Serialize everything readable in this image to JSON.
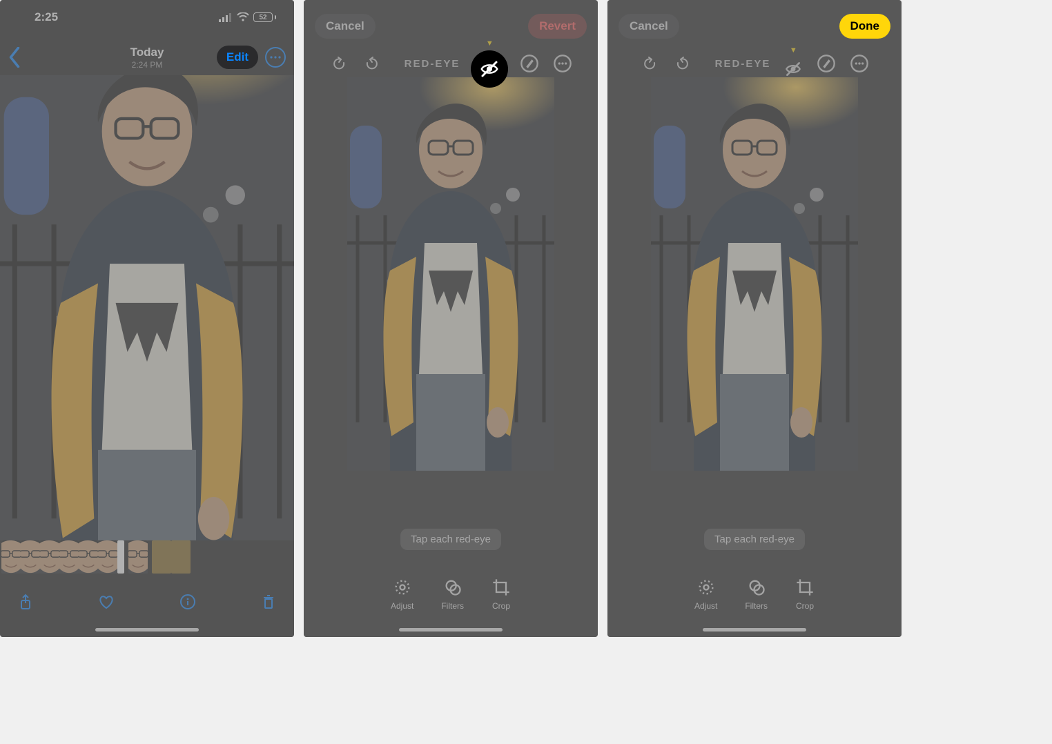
{
  "screen1": {
    "status": {
      "time": "2:25",
      "battery": "52"
    },
    "nav": {
      "title": "Today",
      "subtitle": "2:24 PM",
      "edit_label": "Edit"
    }
  },
  "screen2": {
    "cancel_label": "Cancel",
    "revert_label": "Revert",
    "tool_label": "RED-EYE",
    "hint": "Tap each red-eye",
    "modes": {
      "adjust": "Adjust",
      "filters": "Filters",
      "crop": "Crop"
    }
  },
  "screen3": {
    "cancel_label": "Cancel",
    "done_label": "Done",
    "tool_label": "RED-EYE",
    "hint": "Tap each red-eye",
    "modes": {
      "adjust": "Adjust",
      "filters": "Filters",
      "crop": "Crop"
    }
  }
}
